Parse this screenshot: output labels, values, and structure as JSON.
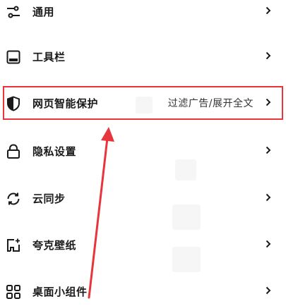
{
  "settings": {
    "items": [
      {
        "key": "general",
        "label": "通用",
        "icon": "sliders-icon",
        "value": ""
      },
      {
        "key": "toolbar",
        "label": "工具栏",
        "icon": "toolbar-icon",
        "value": ""
      },
      {
        "key": "web-protection",
        "label": "网页智能保护",
        "icon": "shield-icon",
        "value": "过滤广告/展开全文"
      },
      {
        "key": "privacy",
        "label": "隐私设置",
        "icon": "lock-icon",
        "value": ""
      },
      {
        "key": "cloud-sync",
        "label": "云同步",
        "icon": "sync-icon",
        "value": ""
      },
      {
        "key": "wallpaper",
        "label": "夸克壁纸",
        "icon": "wallpaper-icon",
        "value": ""
      },
      {
        "key": "widgets",
        "label": "桌面小组件",
        "icon": "widgets-icon",
        "value": ""
      }
    ]
  },
  "annotation": {
    "highlight_color": "#e8353b",
    "highlighted_item": "网页智能保护"
  }
}
